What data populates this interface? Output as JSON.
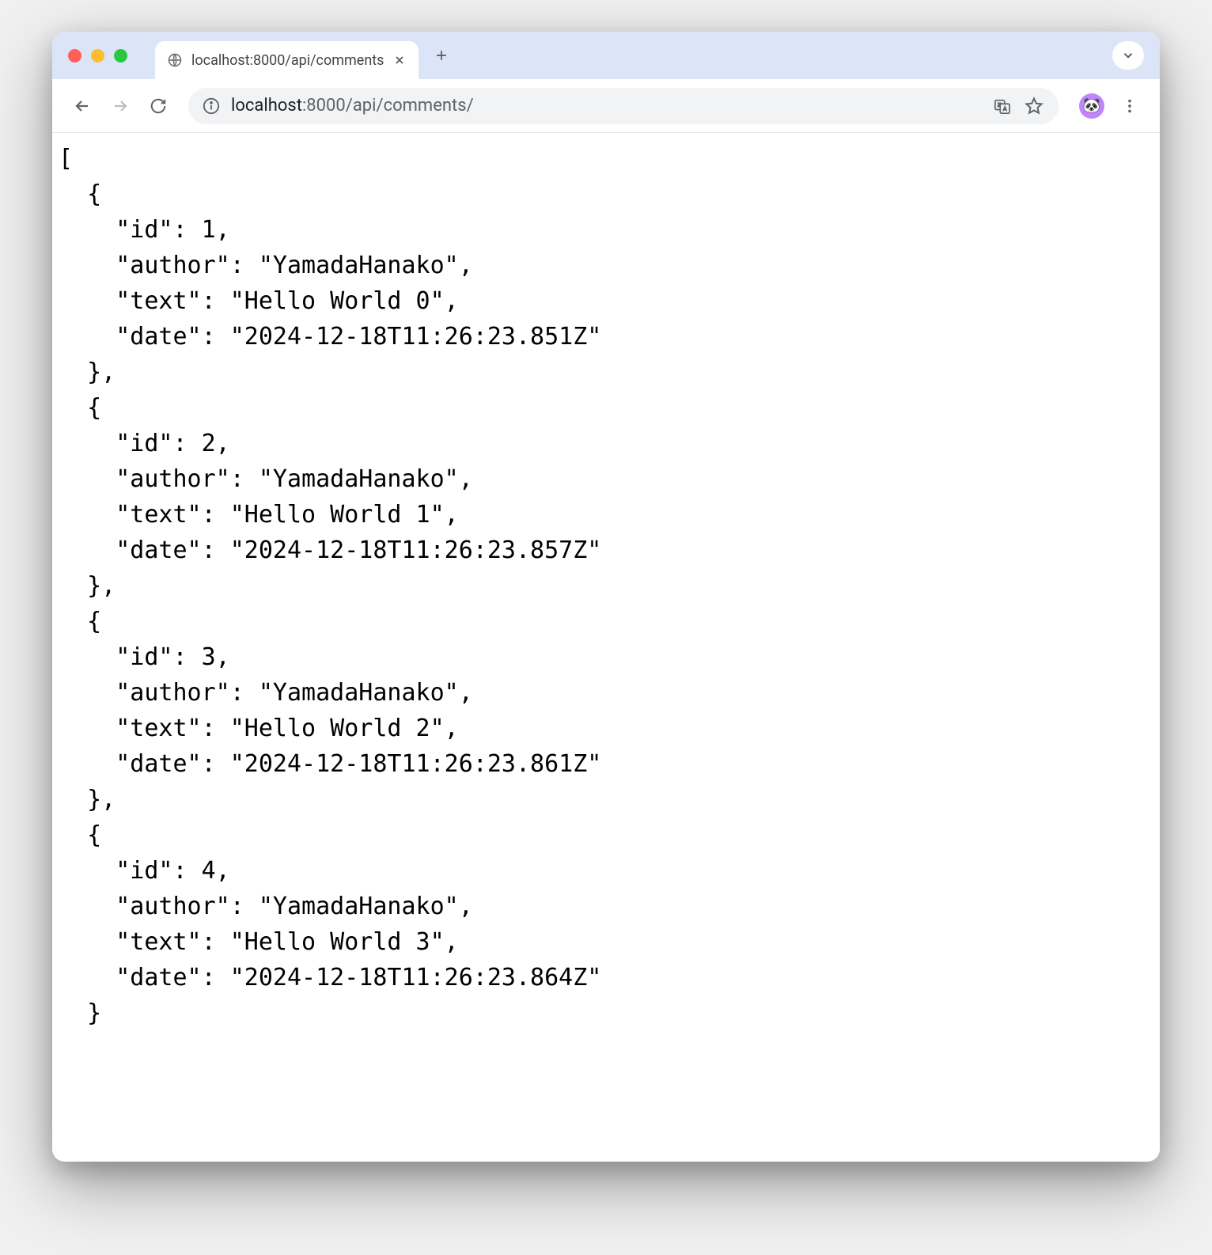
{
  "browser": {
    "tab_title": "localhost:8000/api/comments",
    "url_host": "localhost",
    "url_port_path": ":8000/api/comments/",
    "avatar_emoji": "🐼"
  },
  "api_response": {
    "comments": [
      {
        "id": 1,
        "author": "YamadaHanako",
        "text": "Hello World 0",
        "date": "2024-12-18T11:26:23.851Z"
      },
      {
        "id": 2,
        "author": "YamadaHanako",
        "text": "Hello World 1",
        "date": "2024-12-18T11:26:23.857Z"
      },
      {
        "id": 3,
        "author": "YamadaHanako",
        "text": "Hello World 2",
        "date": "2024-12-18T11:26:23.861Z"
      },
      {
        "id": 4,
        "author": "YamadaHanako",
        "text": "Hello World 3",
        "date": "2024-12-18T11:26:23.864Z"
      }
    ]
  }
}
